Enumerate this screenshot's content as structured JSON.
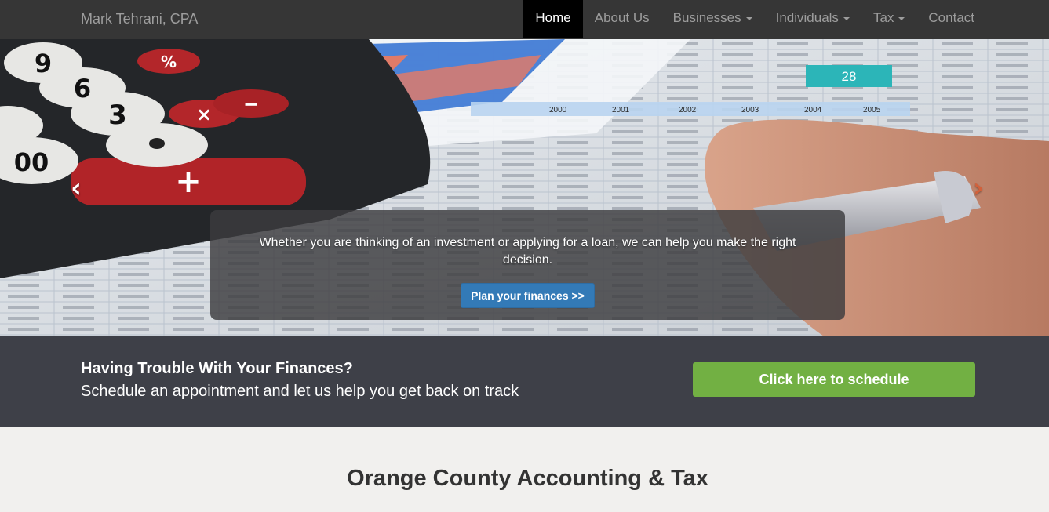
{
  "navbar": {
    "brand": "Mark Tehrani, CPA",
    "items": [
      {
        "label": "Home",
        "active": true,
        "dropdown": false
      },
      {
        "label": "About Us",
        "active": false,
        "dropdown": false
      },
      {
        "label": "Businesses",
        "active": false,
        "dropdown": true
      },
      {
        "label": "Individuals",
        "active": false,
        "dropdown": true
      },
      {
        "label": "Tax",
        "active": false,
        "dropdown": true
      },
      {
        "label": "Contact",
        "active": false,
        "dropdown": false
      }
    ]
  },
  "hero": {
    "caption": "Whether you are thinking of an investment or applying for a loan, we can help you make the right decision.",
    "button": "Plan your finances >>",
    "prev_icon": "chevron-left-icon",
    "next_icon": "chevron-right-icon",
    "calculator_keys": [
      "%",
      "×",
      "−",
      "+",
      "9",
      "6",
      "3",
      "00"
    ],
    "paper_labels": [
      "28",
      "2000",
      "2001",
      "2002",
      "2003",
      "2004",
      "2005"
    ]
  },
  "band": {
    "title": "Having Trouble With Your Finances?",
    "subtitle": "Schedule an appointment and let us help you get back on track",
    "button": "Click here to schedule"
  },
  "content": {
    "title": "Orange County Accounting & Tax"
  },
  "colors": {
    "navbar": "#363636",
    "band": "#3e4048",
    "schedule_button": "#72b043",
    "hero_button": "#337ab7"
  }
}
